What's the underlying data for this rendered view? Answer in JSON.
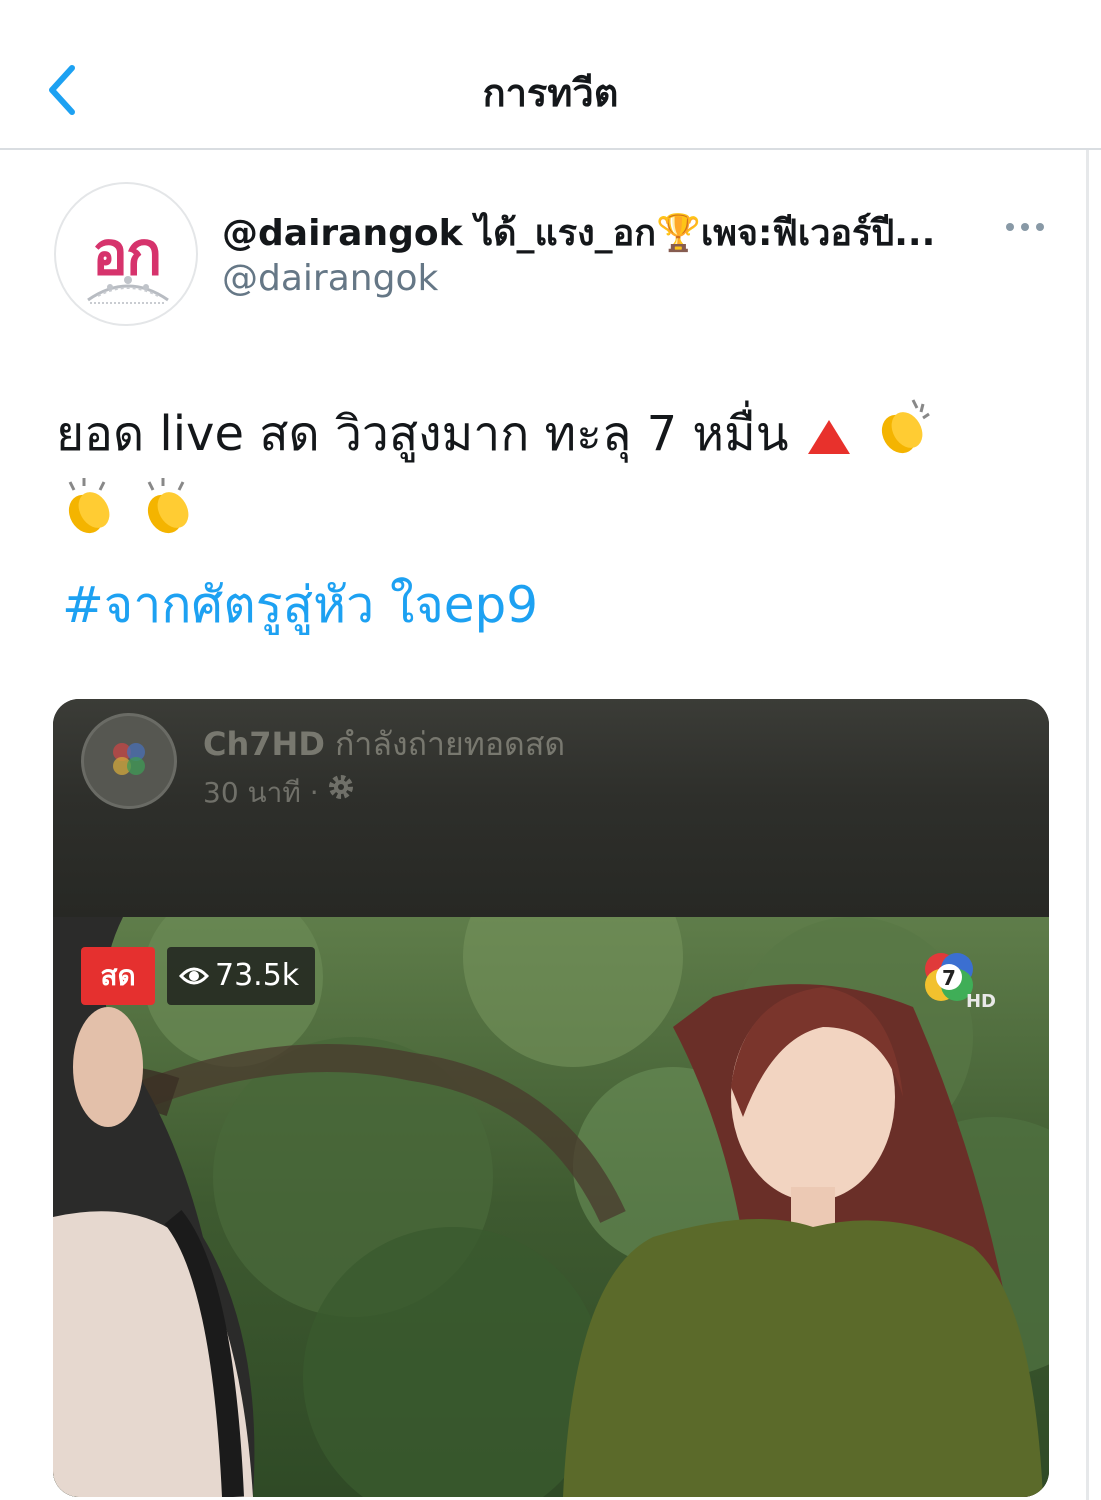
{
  "header": {
    "title": "การทวีต",
    "back_icon": "chevron-left-icon"
  },
  "tweet": {
    "display_name": "@dairangok ได้_แรง_อก🏆เพจ:ฟีเวอร์ปี...",
    "handle": "@dairangok",
    "avatar_logo_text": "อก",
    "more_icon": "more-dots-icon",
    "text": "ยอด live สด วิวสูงมาก ทะลุ 7 หมื่น",
    "emojis": [
      "red-triangle-up",
      "clapping-hands",
      "clapping-hands",
      "clapping-hands"
    ],
    "hashtag": "#จากศัตรูสู่หัว ใจep9"
  },
  "media": {
    "channel_name": "Ch7HD",
    "status": "กำลังถ่ายทอดสด",
    "time_ago": "30 นาที ·",
    "settings_icon": "gear-icon",
    "live_label": "สด",
    "viewer_count": "73.5k",
    "viewer_icon": "eye-icon",
    "channel_logo": "ch7-hd-logo"
  },
  "colors": {
    "accent": "#1da1f2",
    "secondary_text": "#657786",
    "live_red": "#e5302f"
  }
}
